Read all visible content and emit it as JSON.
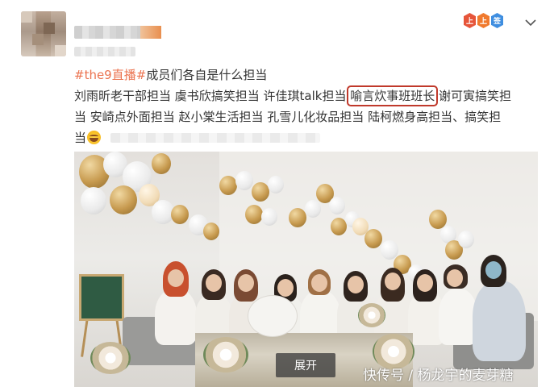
{
  "post": {
    "hashtag": "#the9直播#",
    "lines": [
      "成员们各自是什么担当",
      "刘雨昕老干部担当 虞书欣搞笑担当 许佳琪talk担当",
      "喻言炊事班班长",
      " 谢可寅搞笑担",
      "当 安崎点外面担当 赵小棠生活担当 孔雪儿化妆品担当 陆柯燃身高担当、搞笑担",
      "当"
    ],
    "emoji_icon": "laughing-emoji-icon",
    "expand_label": "展开"
  },
  "header": {
    "badges": [
      "上",
      "上",
      "签"
    ],
    "chevron_icon": "chevron-down-icon"
  },
  "watermark": "快传号 / 杨龙宇的麦芽糖",
  "colors": {
    "hashtag": "#eb7350",
    "highlight_box": "#c0392b",
    "text": "#333333"
  }
}
